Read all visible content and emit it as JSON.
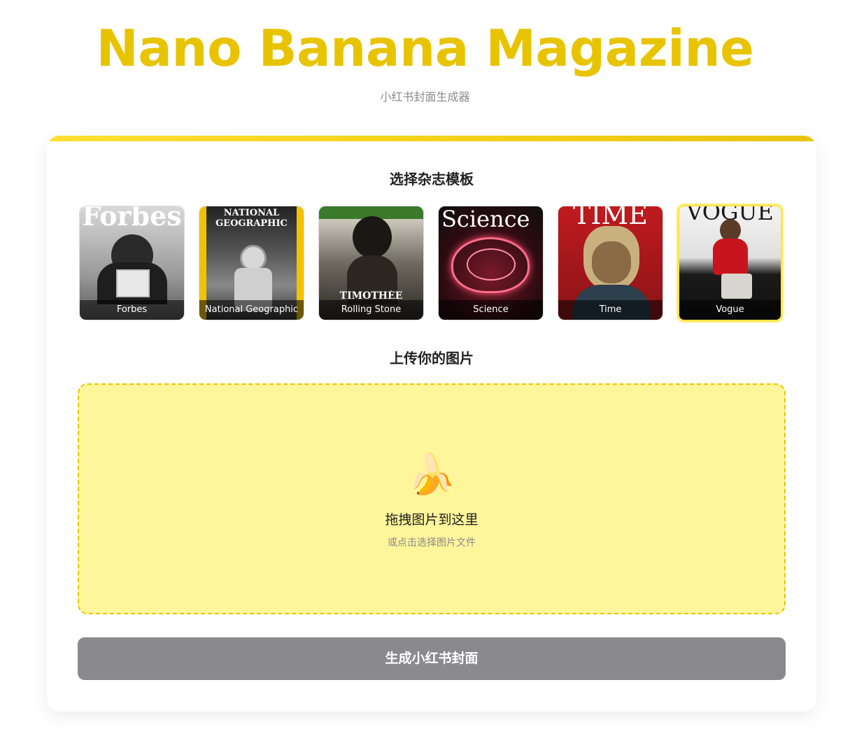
{
  "header": {
    "title": "Nano Banana Magazine",
    "subtitle": "小红书封面生成器"
  },
  "templates_section": {
    "heading": "选择杂志模板",
    "selected": "Vogue",
    "items": [
      {
        "label": "Forbes",
        "cover_text": "Forbes",
        "selected": false
      },
      {
        "label": "National Geographic",
        "cover_text": "NATIONAL GEOGRAPHIC",
        "selected": false
      },
      {
        "label": "Rolling Stone",
        "cover_text": "TIMOTHÉE",
        "selected": false
      },
      {
        "label": "Science",
        "cover_text": "Science",
        "selected": false
      },
      {
        "label": "Time",
        "cover_text": "TIME",
        "selected": false
      },
      {
        "label": "Vogue",
        "cover_text": "VOGUE",
        "selected": true
      }
    ]
  },
  "upload_section": {
    "heading": "上传你的图片",
    "icon": "banana-icon",
    "icon_glyph": "🍌",
    "title": "拖拽图片到这里",
    "hint": "或点击选择图片文件"
  },
  "generate_button": {
    "label": "生成小红书封面",
    "disabled": true
  },
  "colors": {
    "brand": "#e8c400",
    "upload_bg": "#fff59b",
    "button_disabled": "#8a8a8e"
  }
}
